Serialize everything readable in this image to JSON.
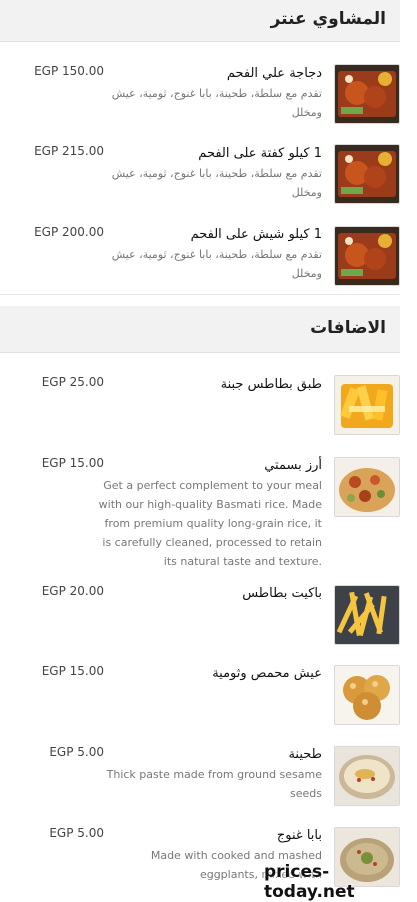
{
  "sections": {
    "grills": {
      "title": "المشاوي عنتر"
    },
    "addons": {
      "title": "الاضافات"
    }
  },
  "grill_items": [
    {
      "name": "دجاجة علي الفحم",
      "description": "تقدم مع سلطة، طحينة، بابا غنوج، ثومية، عيش ومخلل",
      "price": "EGP 150.00",
      "image": "grilled-platter"
    },
    {
      "name": "1 كيلو كفتة على الفحم",
      "description": "تقدم مع سلطة، طحينة، بابا غنوج، ثومية، عيش ومخلل",
      "price": "EGP 215.00",
      "image": "grilled-platter"
    },
    {
      "name": "1 كيلو شيش على الفحم",
      "description": "تقدم مع سلطة، طحينة، بابا غنوج، ثومية، عيش ومخلل",
      "price": "EGP 200.00",
      "image": "grilled-platter"
    }
  ],
  "addon_items": [
    {
      "name": "طبق بطاطس جبنة",
      "description": "",
      "price": "EGP 25.00",
      "image": "cheese-fries"
    },
    {
      "name": "أرز بسمتي",
      "description": "Get a perfect complement to your meal with our high-quality Basmati rice. Made from premium quality long-grain rice, it is carefully cleaned, processed to retain its natural taste and texture.",
      "price": "EGP 15.00",
      "image": "rice-dish"
    },
    {
      "name": "باكيت بطاطس",
      "description": "",
      "price": "EGP 20.00",
      "image": "french-fries"
    },
    {
      "name": "عيش محمص وثومية",
      "description": "",
      "price": "EGP 15.00",
      "image": "bread-rolls"
    },
    {
      "name": "طحينة",
      "description": "Thick paste made from ground sesame seeds",
      "price": "EGP 5.00",
      "image": "tahini-bowl"
    },
    {
      "name": "بابا غنوج",
      "description": "Made with cooked and mashed eggplants, mixed with",
      "price": "EGP 5.00",
      "image": "baba-ghanoush"
    }
  ],
  "watermark": "prices-today.net",
  "colors": {
    "header_bg": "#f2f2f2",
    "divider": "#e6e6e6",
    "desc": "#777777",
    "price": "#444444"
  }
}
